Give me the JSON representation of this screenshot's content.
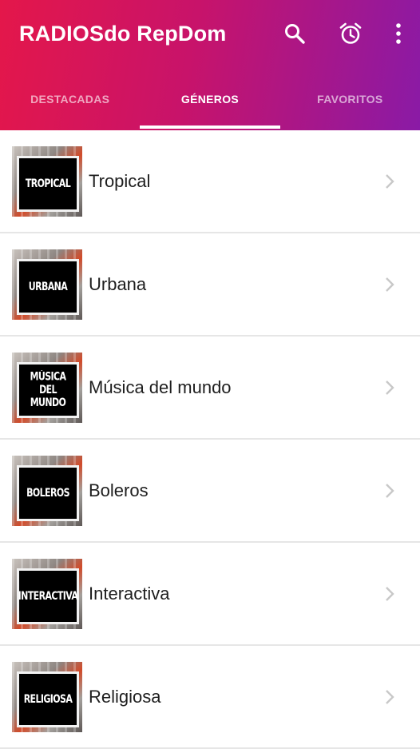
{
  "app": {
    "title": "RADIOSdo RepDom"
  },
  "toolbar": {
    "icons": [
      "search-icon",
      "alarm-clock-icon",
      "more-vertical-icon"
    ]
  },
  "tabs": [
    {
      "label": "DESTACADAS",
      "active": false
    },
    {
      "label": "GÉNEROS",
      "active": true
    },
    {
      "label": "FAVORITOS",
      "active": false
    }
  ],
  "genres": [
    {
      "label": "Tropical",
      "thumb_text": "TROPICAL"
    },
    {
      "label": "Urbana",
      "thumb_text": "URBANA"
    },
    {
      "label": "Música del mundo",
      "thumb_text": "MÚSICA DEL MUNDO"
    },
    {
      "label": "Boleros",
      "thumb_text": "BOLEROS"
    },
    {
      "label": "Interactiva",
      "thumb_text": "INTERACTIVA"
    },
    {
      "label": "Religiosa",
      "thumb_text": "RELIGIOSA"
    }
  ],
  "colors": {
    "gradient_start": "#e4174a",
    "gradient_end": "#8a1aa6",
    "tab_active": "#ffffff",
    "tab_inactive": "#f5a6c4",
    "divider": "#e6e6e6",
    "chevron": "#c8c8c8"
  }
}
